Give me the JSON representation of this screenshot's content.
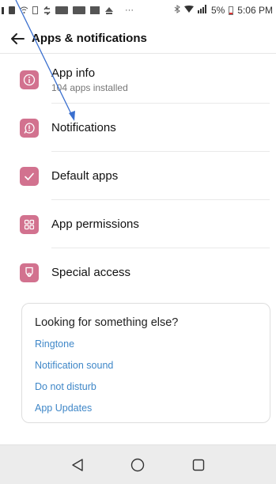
{
  "status_bar": {
    "battery": "5%",
    "time": "5:06 PM"
  },
  "header": {
    "title": "Apps & notifications"
  },
  "items": [
    {
      "title": "App info",
      "subtitle": "104 apps installed",
      "icon": "info-icon"
    },
    {
      "title": "Notifications",
      "icon": "notification-bubble-icon"
    },
    {
      "title": "Default apps",
      "icon": "check-icon"
    },
    {
      "title": "App permissions",
      "icon": "grid-icon"
    },
    {
      "title": "Special access",
      "icon": "medal-icon"
    }
  ],
  "card": {
    "title": "Looking for something else?",
    "links": [
      "Ringtone",
      "Notification sound",
      "Do not disturb",
      "App Updates"
    ]
  },
  "colors": {
    "icon_bg": "#d2728f",
    "link": "#3f87c8",
    "annotation": "#3a6fcf"
  }
}
